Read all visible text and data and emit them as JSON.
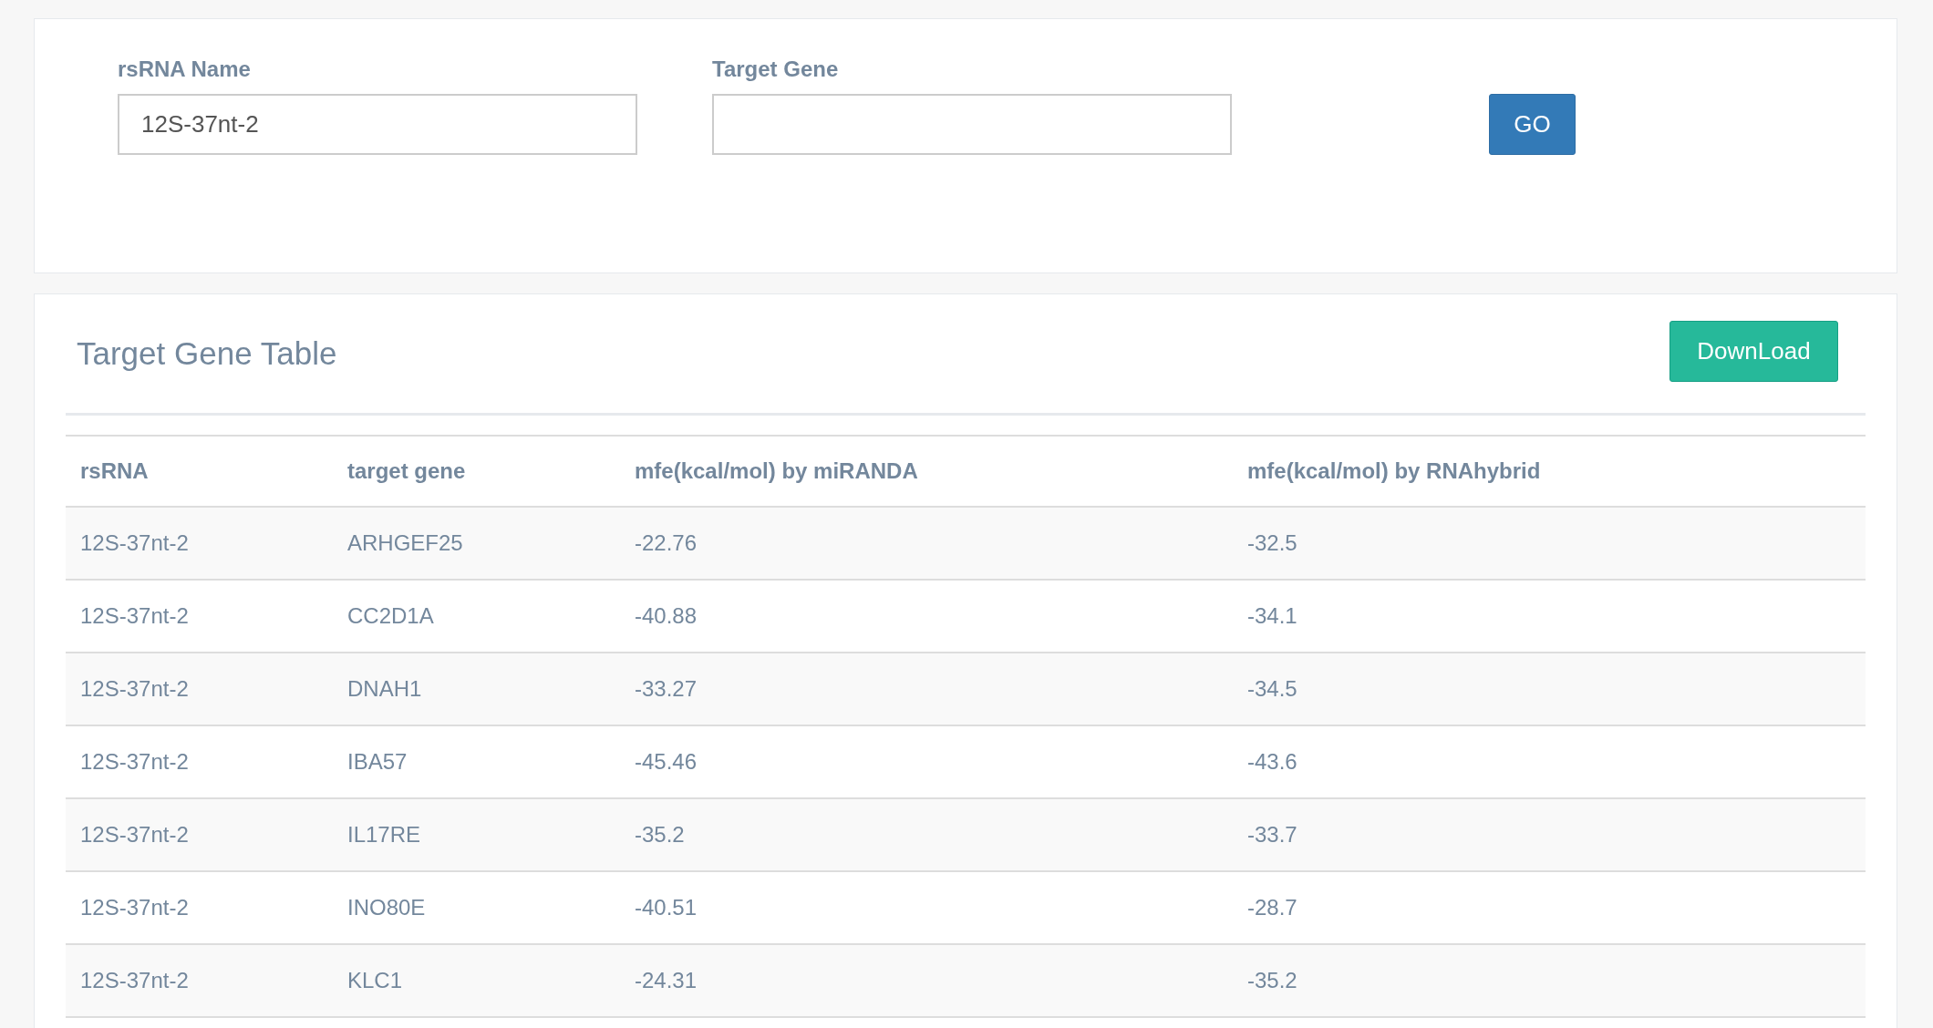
{
  "search_form": {
    "fields": [
      {
        "label": "rsRNA Name",
        "value": "12S-37nt-2"
      },
      {
        "label": "Target Gene"
      }
    ],
    "go_button": "GO"
  },
  "target_gene_table": {
    "title": "Target Gene Table",
    "download_button": "DownLoad",
    "columns": [
      "rsRNA",
      "target gene",
      "mfe(kcal/mol) by miRANDA",
      "mfe(kcal/mol) by RNAhybrid"
    ],
    "rows": [
      [
        "12S-37nt-2",
        "ARHGEF25",
        "-22.76",
        "-32.5"
      ],
      [
        "12S-37nt-2",
        "CC2D1A",
        "-40.88",
        "-34.1"
      ],
      [
        "12S-37nt-2",
        "DNAH1",
        "-33.27",
        "-34.5"
      ],
      [
        "12S-37nt-2",
        "IBA57",
        "-45.46",
        "-43.6"
      ],
      [
        "12S-37nt-2",
        "IL17RE",
        "-35.2",
        "-33.7"
      ],
      [
        "12S-37nt-2",
        "INO80E",
        "-40.51",
        "-28.7"
      ],
      [
        "12S-37nt-2",
        "KLC1",
        "-24.31",
        "-35.2"
      ]
    ]
  }
}
